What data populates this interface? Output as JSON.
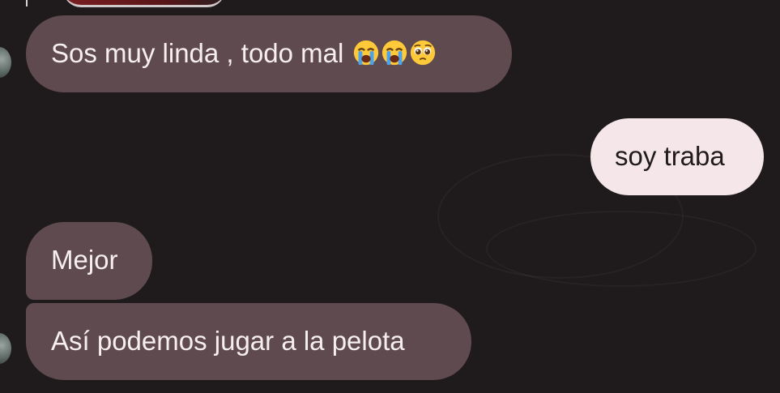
{
  "conversation": {
    "messages": [
      {
        "direction": "incoming",
        "text": "Sos muy linda , todo mal",
        "emojis": [
          "loudly-crying-face-icon",
          "loudly-crying-face-icon",
          "pleading-face-icon"
        ]
      },
      {
        "direction": "outgoing",
        "text": "soy traba"
      },
      {
        "direction": "incoming",
        "text": "Mejor"
      },
      {
        "direction": "incoming",
        "text": "Así podemos jugar a la pelota"
      }
    ]
  },
  "colors": {
    "background": "#1f1a1b",
    "incoming_bubble": "#5f4b4f",
    "outgoing_bubble": "#f4e6e9"
  }
}
